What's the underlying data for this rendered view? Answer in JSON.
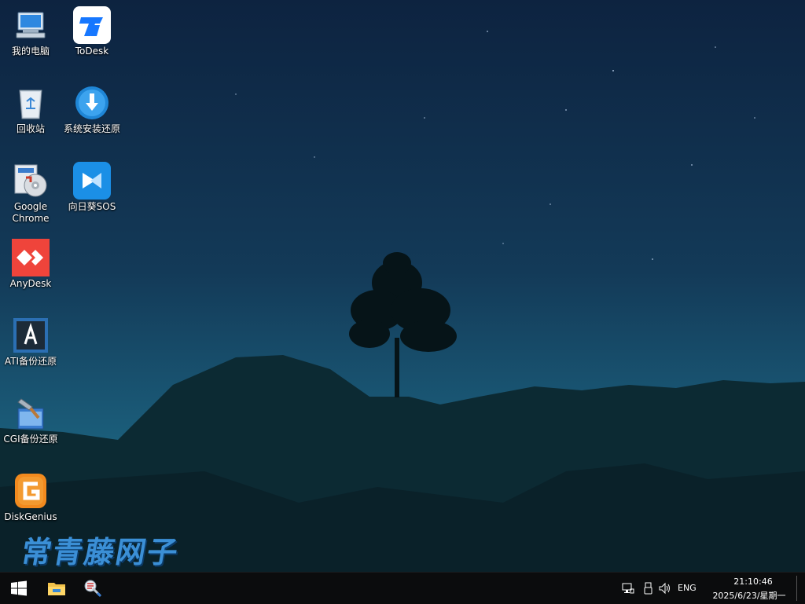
{
  "desktop": {
    "icons": [
      {
        "label": "我的电脑",
        "icon": "computer-icon"
      },
      {
        "label": "ToDesk",
        "icon": "todesk-icon"
      },
      {
        "label": "回收站",
        "icon": "recycle-bin-icon"
      },
      {
        "label": "系统安装还原",
        "icon": "system-install-restore-icon"
      },
      {
        "label": "Google Chrome",
        "icon": "chrome-installer-icon"
      },
      {
        "label": "向日葵SOS",
        "icon": "sunlogin-sos-icon"
      },
      {
        "label": "AnyDesk",
        "icon": "anydesk-icon"
      },
      {
        "label": "ATI备份还原",
        "icon": "ati-backup-icon"
      },
      {
        "label": "CGI备份还原",
        "icon": "cgi-backup-icon"
      },
      {
        "label": "DiskGenius",
        "icon": "diskgenius-icon"
      }
    ],
    "watermark": "常青藤网子"
  },
  "taskbar": {
    "start_icon": "windows-start-icon",
    "pinned": [
      "file-explorer-icon",
      "tool-app-icon"
    ],
    "tray": {
      "icons": [
        "network-icon",
        "usb-icon",
        "volume-icon"
      ],
      "language": "ENG",
      "time": "21:10:46",
      "date": "2025/6/23/星期一"
    }
  },
  "colors": {
    "taskbar": "#0b0c0d",
    "sky_top": "#0e2440",
    "sky_horizon": "#1d5e79",
    "watermark": "#3b8fd6"
  }
}
